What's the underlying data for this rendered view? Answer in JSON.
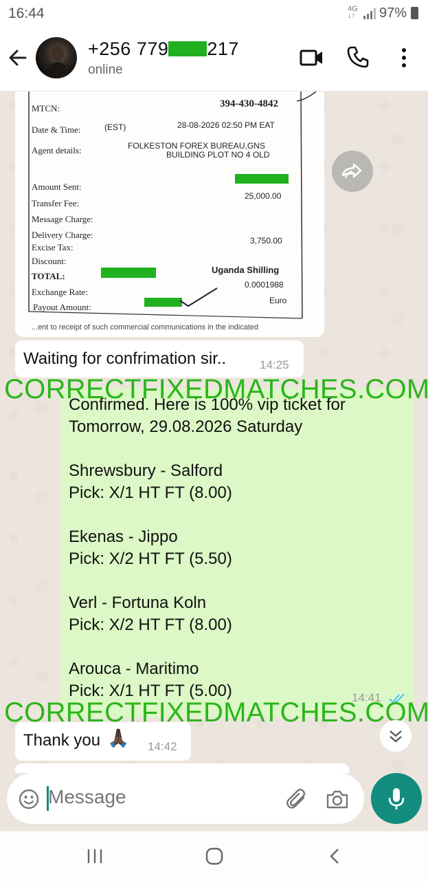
{
  "status_bar": {
    "time": "16:44",
    "network": "4G",
    "battery": "97%"
  },
  "header": {
    "contact_name_prefix": "+256 779",
    "contact_name_suffix": "217",
    "status": "online"
  },
  "receipt": {
    "mtcn_label": "MTCN:",
    "mtcn_value": "394-430-4842",
    "datetime_label": "Date & Time:",
    "datetime_zone": "(EST)",
    "datetime_value": "28-08-2026 02:50 PM EAT",
    "agent_label": "Agent details:",
    "agent_line1": "FOLKESTON FOREX BUREAU,GNS",
    "agent_line2": "BUILDING PLOT NO 4 OLD",
    "amount_sent_label": "Amount Sent:",
    "transfer_fee_label": "Transfer Fee:",
    "transfer_fee_value": "25,000.00",
    "message_charge_label": "Message Charge:",
    "delivery_charge_label": "Delivery Charge:",
    "excise_tax_label": "Excise Tax:",
    "excise_tax_value": "3,750.00",
    "discount_label": "Discount:",
    "total_label": "TOTAL:",
    "currency": "Uganda Shilling",
    "exchange_rate_label": "Exchange Rate:",
    "exchange_rate_value": "0.0001988",
    "payout_label": "Payout Amount:",
    "payout_currency": "Euro",
    "footer_text": "...ent to receipt of such commercial communications in the indicated"
  },
  "messages": [
    {
      "id": "msg-waiting",
      "text": "Waiting for confrimation sir..",
      "time": "14:25"
    },
    {
      "id": "msg-confirmed",
      "text": "Confirmed. Here is 100% vip ticket for\nTomorrow, 29.08.2026 Saturday\n\nShrewsbury - Salford\nPick: X/1 HT FT (8.00)\n\nEkenas - Jippo\nPick: X/2 HT FT (5.50)\n\nVerl - Fortuna Koln\nPick: X/2 HT FT (8.00)\n\nArouca - Maritimo\nPick: X/1 HT FT (5.00)",
      "time": "14:41"
    },
    {
      "id": "msg-thanks",
      "text": "Thank you",
      "emoji": "🙏🏿",
      "time": "14:42"
    }
  ],
  "watermark": "CORRECTFIXEDMATCHES.COM",
  "input": {
    "placeholder": "Message"
  },
  "colors": {
    "header_bg": "#ffffff",
    "chat_bg": "#ece5dd",
    "outgoing_bubble": "#dcf8c6",
    "incoming_bubble": "#ffffff",
    "watermark": "#2bb51b",
    "accent": "#128c7e",
    "read_ticks": "#4fc3f7"
  },
  "icons": {
    "back": "arrow-left-icon",
    "video": "video-camera-icon",
    "call": "phone-icon",
    "more": "more-vertical-icon",
    "forward": "forward-icon",
    "emoji": "smiley-icon",
    "attach": "paperclip-icon",
    "camera": "camera-icon",
    "mic": "microphone-icon",
    "scroll": "double-chevron-down-icon",
    "nav_recents": "recents-icon",
    "nav_home": "home-icon",
    "nav_back": "nav-back-icon"
  }
}
